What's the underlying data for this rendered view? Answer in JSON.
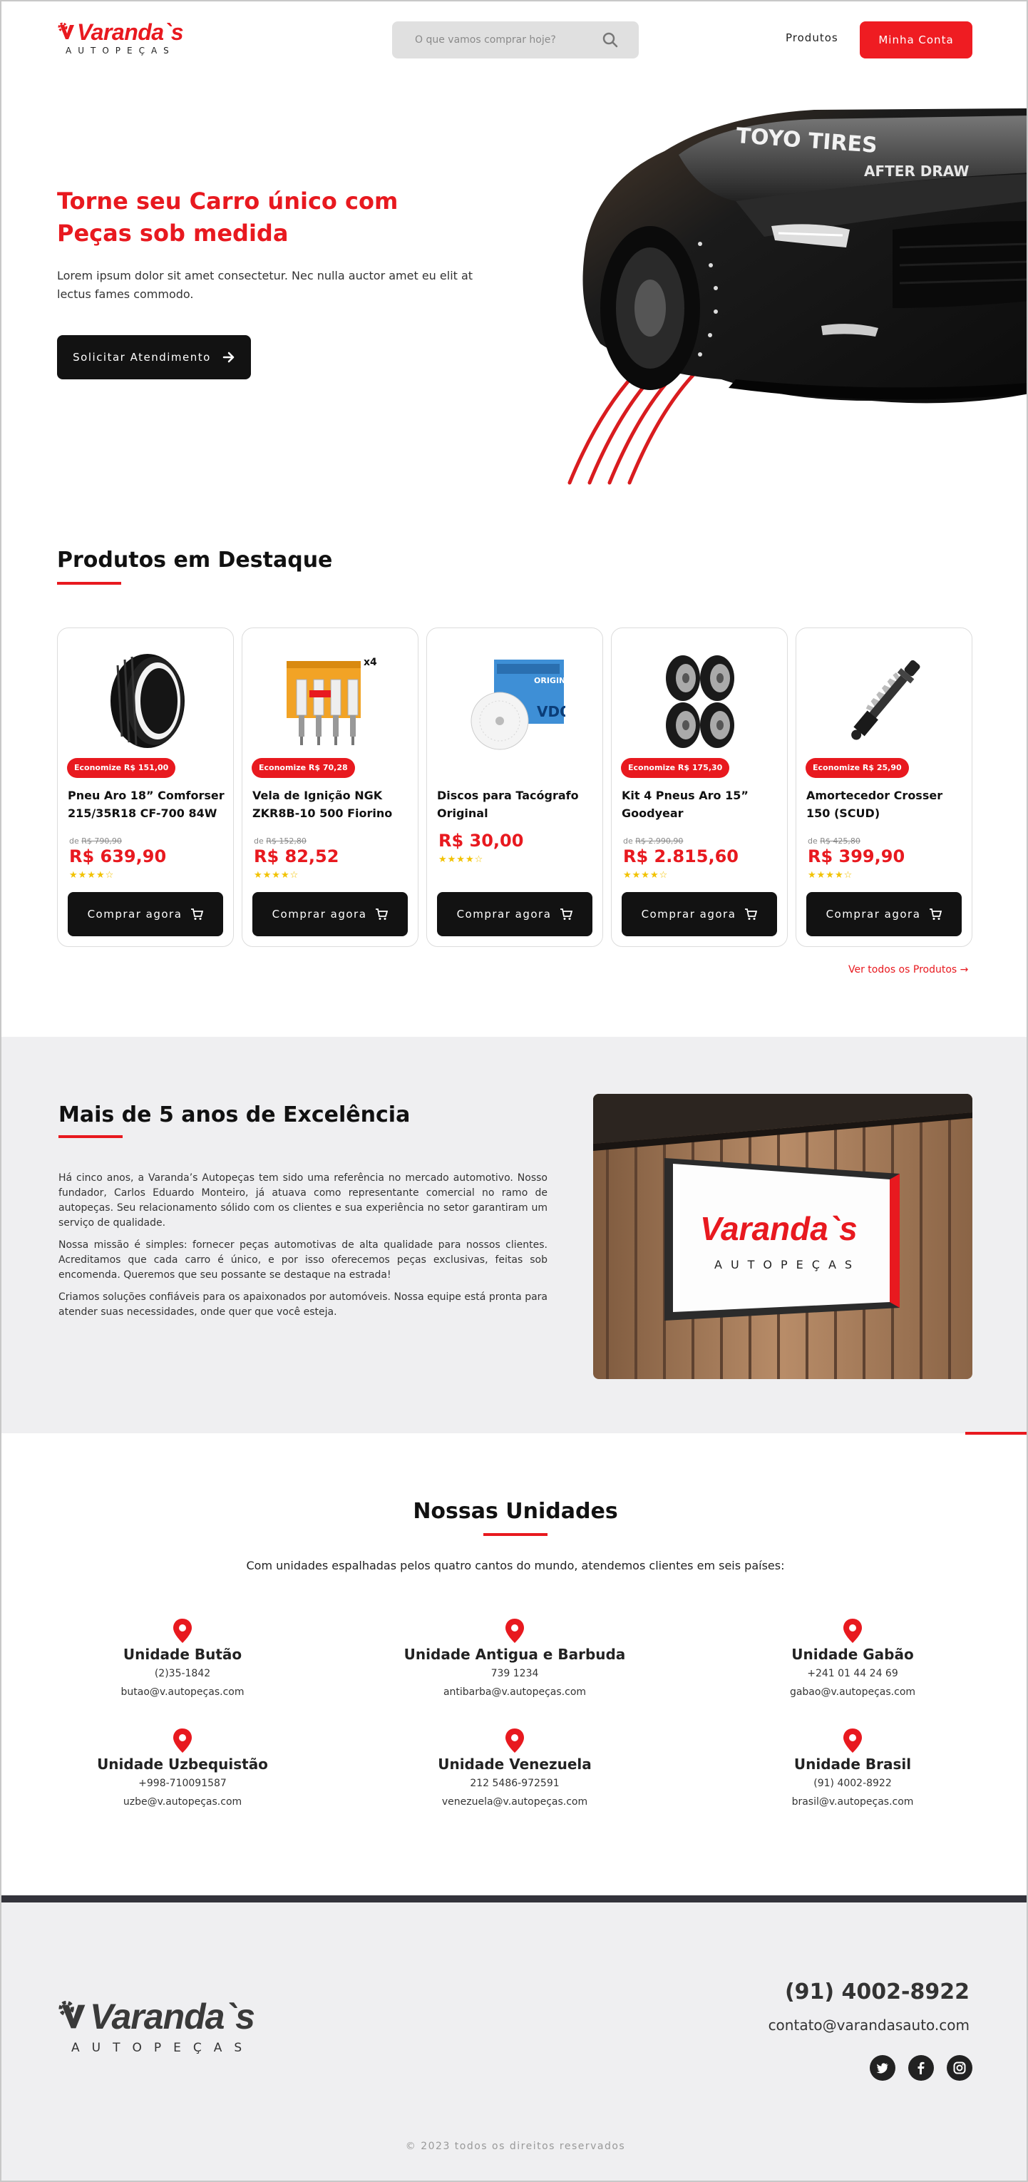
{
  "header": {
    "brand": "Varanda`s",
    "brand_sub": "AUTOPEÇAS",
    "search_placeholder": "O que vamos comprar hoje?",
    "nav_products": "Produtos",
    "account_button": "Minha Conta"
  },
  "hero": {
    "title_line1": "Torne seu Carro único com",
    "title_line2": "Peças sob medida",
    "text": "Lorem ipsum dolor sit amet consectetur. Nec nulla auctor amet eu elit at lectus fames commodo.",
    "button": "Solicitar Atendimento",
    "car_windshield": "TOYO TIRES",
    "car_plate": "AFTER DRAW"
  },
  "featured": {
    "title": "Produtos em Destaque",
    "see_all": "Ver todos os Produtos",
    "buy_label": "Comprar agora",
    "products": [
      {
        "name": "Pneu Aro 18” Comforser 215/35R18 CF-700 84W",
        "badge": "Economize R$ 151,00",
        "old_prefix": "de",
        "old_price": "R$ 790,90",
        "price": "R$ 639,90",
        "rating": 4.5
      },
      {
        "name": "Vela de Ignição NGK ZKR8B-10 500 Fiorino",
        "badge": "Economize R$ 70,28",
        "old_prefix": "de",
        "old_price": "R$ 152,80",
        "price": "R$ 82,52",
        "rating": 4.5,
        "pack_label": "x4"
      },
      {
        "name": "Discos para Tacógrafo Original",
        "badge": "",
        "old_prefix": "",
        "old_price": "",
        "price": "R$ 30,00",
        "rating": 4.5,
        "box_label": "ORIGINAL",
        "box_brand": "VDO"
      },
      {
        "name": "Kit 4 Pneus Aro 15” Goodyear",
        "badge": "Economize R$ 175,30",
        "old_prefix": "de",
        "old_price": "R$ 2.990,90",
        "price": "R$ 2.815,60",
        "rating": 4.5
      },
      {
        "name": "Amortecedor Crosser 150 (SCUD)",
        "badge": "Economize R$ 25,90",
        "old_prefix": "de",
        "old_price": "R$ 425,80",
        "price": "R$ 399,90",
        "rating": 4.5
      }
    ]
  },
  "about": {
    "title": "Mais de 5 anos de Excelência",
    "paragraphs": [
      "Há cinco anos, a Varanda’s Autopeças tem sido uma referência no mercado automotivo. Nosso fundador, Carlos Eduardo Monteiro, já atuava como representante comercial no ramo de autopeças. Seu relacionamento sólido com os clientes e sua experiência no setor garantiram um serviço de qualidade.",
      "Nossa missão é simples: fornecer peças automotivas de alta qualidade para nossos clientes. Acreditamos que cada carro é único, e por isso oferecemos peças exclusivas, feitas sob encomenda. Queremos que seu possante se destaque na estrada!",
      "Criamos soluções confiáveis para os apaixonados por automóveis. Nossa equipe está pronta para atender suas necessidades, onde quer que você esteja."
    ],
    "sign_brand": "Varanda`s",
    "sign_sub": "AUTOPEÇAS"
  },
  "units": {
    "title": "Nossas Unidades",
    "intro": "Com unidades espalhadas pelos quatro cantos do mundo, atendemos clientes em seis países:",
    "list": [
      {
        "name": "Unidade Butão",
        "phone": "(2)35-1842",
        "email": "butao@v.autopeças.com"
      },
      {
        "name": "Unidade Antigua e Barbuda",
        "phone": "739 1234",
        "email": "antibarba@v.autopeças.com"
      },
      {
        "name": "Unidade Gabão",
        "phone": "+241 01 44 24 69",
        "email": "gabao@v.autopeças.com"
      },
      {
        "name": "Unidade Uzbequistão",
        "phone": "+998-710091587",
        "email": "uzbe@v.autopeças.com"
      },
      {
        "name": "Unidade Venezuela",
        "phone": "212 5486-972591",
        "email": "venezuela@v.autopeças.com"
      },
      {
        "name": "Unidade Brasil",
        "phone": "(91) 4002-8922",
        "email": "brasil@v.autopeças.com"
      }
    ]
  },
  "footer": {
    "brand": "Varanda`s",
    "brand_sub": "AUTOPEÇAS",
    "phone": "(91) 4002-8922",
    "email": "contato@varandasauto.com",
    "socials": [
      "twitter-icon",
      "facebook-icon",
      "instagram-icon"
    ],
    "copyright": "© 2023 todos os direitos reservados"
  },
  "colors": {
    "accent": "#e8191f",
    "dark": "#121212",
    "section_bg": "#efeff1"
  }
}
